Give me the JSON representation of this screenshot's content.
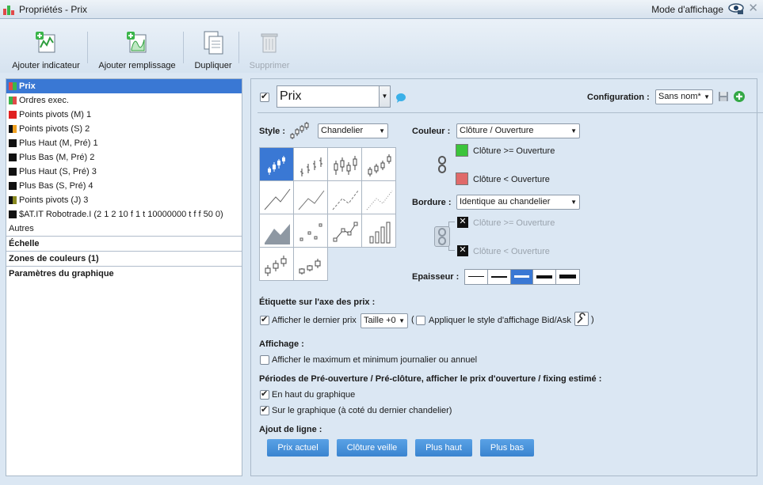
{
  "window": {
    "title": "Propriétés - Prix",
    "mode_label": "Mode d'affichage",
    "icons": [
      "candlestick-app-icon",
      "eye-icon",
      "close-icon"
    ]
  },
  "toolbar": {
    "add_indicator": "Ajouter indicateur",
    "add_fill": "Ajouter remplissage",
    "duplicate": "Dupliquer",
    "delete": "Supprimer"
  },
  "left_panel": {
    "items": [
      {
        "label": "Prix",
        "colors": [
          "#e04a4a",
          "#3bb54a"
        ]
      },
      {
        "label": "Ordres exec.",
        "colors": [
          "#3bb54a",
          "#e04a4a"
        ]
      },
      {
        "label": "Points pivots (M) 1",
        "colors": [
          "#e02020",
          "#e02020"
        ]
      },
      {
        "label": "Points pivots (S) 2",
        "colors": [
          "#111111",
          "#f0a020"
        ]
      },
      {
        "label": "Plus Haut (M, Pré) 1",
        "colors": [
          "#111111",
          "#111111"
        ]
      },
      {
        "label": "Plus Bas (M, Pré) 2",
        "colors": [
          "#111111",
          "#111111"
        ]
      },
      {
        "label": "Plus Haut (S, Pré) 3",
        "colors": [
          "#111111",
          "#111111"
        ]
      },
      {
        "label": "Plus Bas (S, Pré) 4",
        "colors": [
          "#111111",
          "#111111"
        ]
      },
      {
        "label": "Points pivots (J) 3",
        "colors": [
          "#111111",
          "#8a8a20"
        ]
      },
      {
        "label": "$AT.IT Robotrade.I (2 1 2 10 f 1 t 10000000 t f f 50 0)",
        "colors": [
          "#111111",
          "#111111"
        ]
      }
    ],
    "autres": "Autres",
    "sections": [
      "Échelle",
      "Zones de couleurs (1)",
      "Paramètres du graphique"
    ]
  },
  "right_panel": {
    "name_value": "Prix",
    "configuration_label": "Configuration :",
    "configuration_value": "Sans nom*",
    "style_label": "Style :",
    "style_value": "Chandelier",
    "couleur_label": "Couleur :",
    "couleur_value": "Clôture / Ouverture",
    "color_up_label": "Clôture >= Ouverture",
    "color_up": "#3bc43b",
    "color_down_label": "Clôture < Ouverture",
    "color_down": "#e06a6a",
    "bordure_label": "Bordure :",
    "bordure_value": "Identique au chandelier",
    "border_up_label": "Clôture >= Ouverture",
    "border_down_label": "Clôture < Ouverture",
    "epaisseur_label": "Epaisseur :",
    "epaisseur_selected_index": 2,
    "price_axis_heading": "Étiquette sur l'axe des prix :",
    "show_last_price": "Afficher le dernier prix",
    "size_value": "Taille +0",
    "bidask_open": "(",
    "bidask_label": "Appliquer le style d'affichage Bid/Ask",
    "bidask_close": ")",
    "affichage_heading": "Affichage :",
    "show_minmax": "Afficher le maximum et minimum journalier ou annuel",
    "periods_heading": "Périodes de Pré-ouverture / Pré-clôture, afficher le prix d'ouverture / fixing estimé :",
    "top_of_chart": "En haut du graphique",
    "on_chart": "Sur le graphique (à coté du dernier chandelier)",
    "add_line_heading": "Ajout de ligne :",
    "line_buttons": [
      "Prix actuel",
      "Clôture veille",
      "Plus haut",
      "Plus bas"
    ]
  }
}
